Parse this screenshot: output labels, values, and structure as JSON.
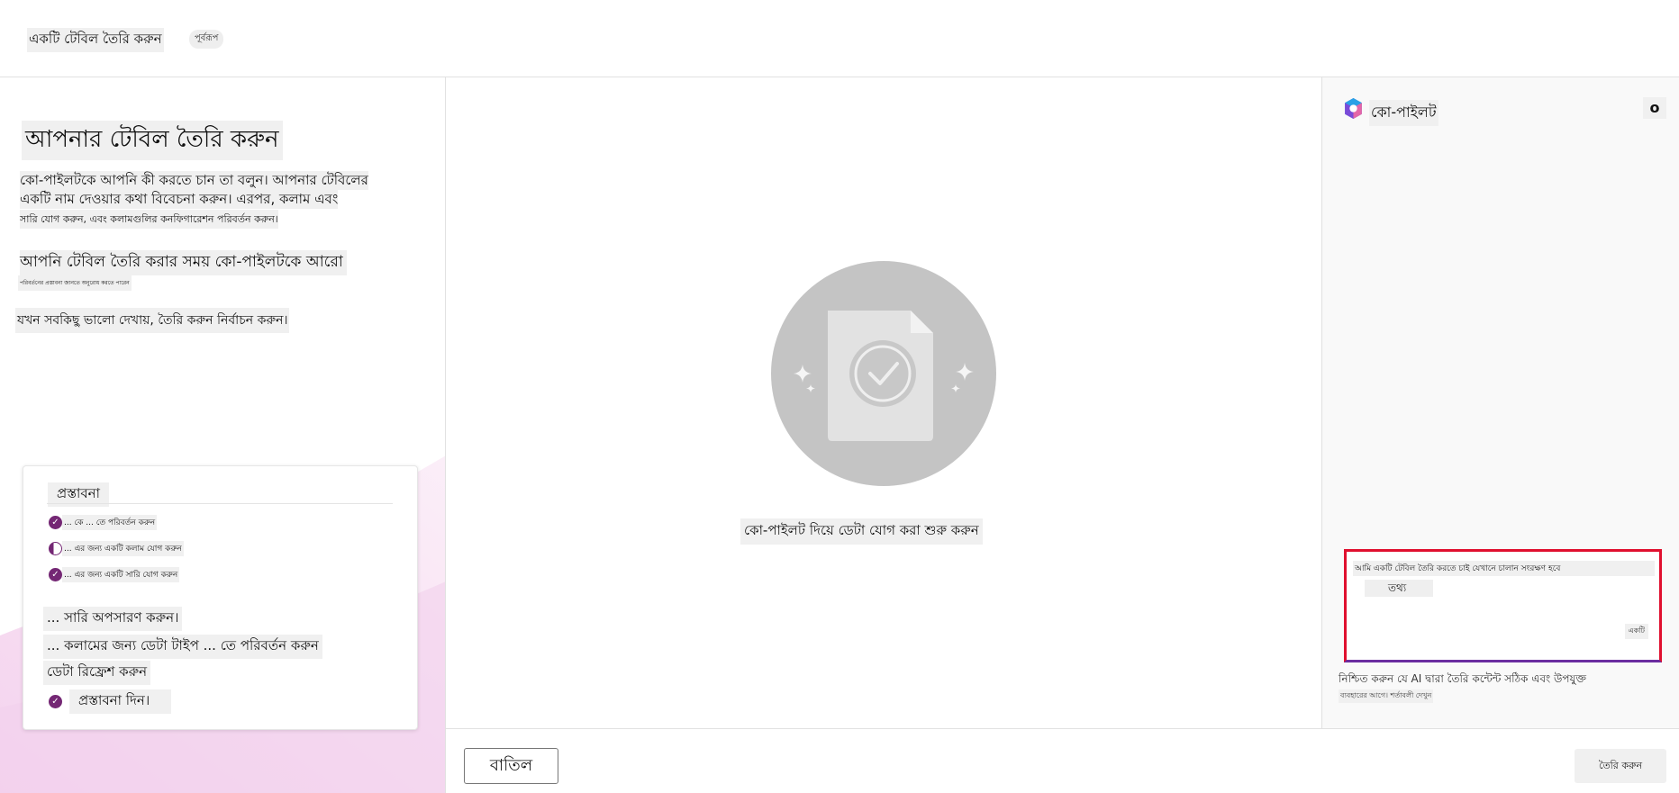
{
  "header": {
    "title": "একটি টেবিল তৈরি করুন",
    "badge": "পূর্বরূপ"
  },
  "left": {
    "title": "আপনার টেবিল তৈরি করুন",
    "desc_line1": "কো-পাইলটকে আপনি কী করতে চান তা বলুন। আপনার টেবিলের",
    "desc_line2": "একটি নাম দেওয়ার কথা বিবেচনা করুন। এরপর, কলাম এবং",
    "desc_line3": "সারি যোগ করুন, এবং কলামগুলির কনফিগারেশন পরিবর্তন করুন।",
    "sub_title": "আপনি টেবিল তৈরি করার সময় কো-পাইলটকে আরো",
    "sub_desc": "পরিবর্তনের প্রস্তাবনা জানতে অনুরোধ করতে পারেন",
    "select_text": "যখন সবকিছু ভালো দেখায়, তৈরি করুন নির্বাচন করুন।",
    "card": {
      "title": "প্রস্তাবনা",
      "row1": "... কে ... তে পরিবর্তন করুন",
      "row2": "... এর জন্য একটি কলাম যোগ করুন",
      "row3": "... এর জন্য একটি সারি যোগ করুন",
      "row4": "... সারি অপসারণ করুন।",
      "row5": "... কলামের জন্য ডেটা টাইপ ... তে পরিবর্তন করুন",
      "row6": "ডেটা রিফ্রেশ করুন",
      "row7": "প্রস্তাবনা দিন।"
    }
  },
  "center": {
    "text": "কো-পাইলট দিয়ে ডেটা যোগ করা শুরু করুন"
  },
  "footer": {
    "cancel_label": "বাতিল",
    "create_label": "তৈরি করুন"
  },
  "copilot": {
    "title": "কো-পাইলট",
    "close_label": "o",
    "input_text": "আমি একটি টেবিল তৈরি করতে চাই যেখানে চালান সংরক্ষণ হবে",
    "chip_label": "তথ্য",
    "send_label": "একটি",
    "disclaimer": "নিশ্চিত করুন যে AI দ্বারা তৈরি কন্টেন্ট সঠিক এবং উপযুক্ত",
    "disclaimer_sub": "ব্যবহারের আগে। শর্তাবলী দেখুন"
  },
  "colors": {
    "accent_purple": "#742774",
    "highlight_red": "#e0102f",
    "illustration_grey": "#c4c4c4"
  }
}
